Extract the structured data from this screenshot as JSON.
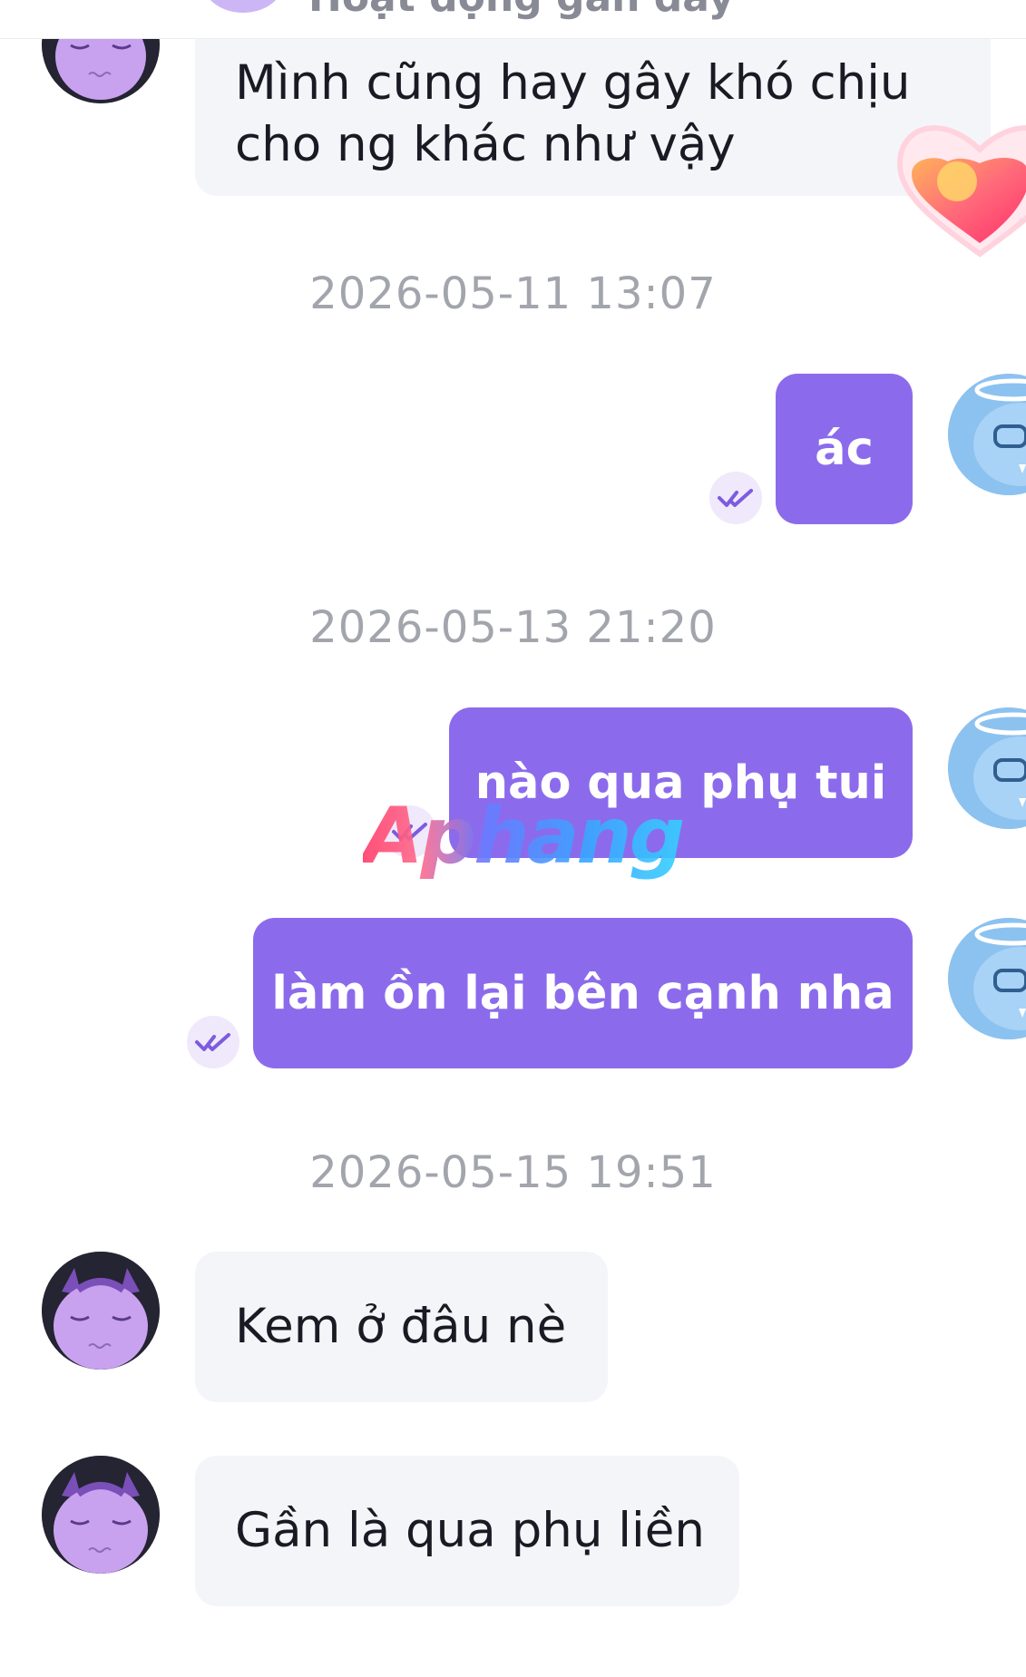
{
  "header": {
    "status": "Hoạt động gần đây"
  },
  "messages": [
    {
      "side": "in",
      "lines": [
        "Mình cũng hay gây khó chịu",
        "cho ng khác như vậy"
      ]
    },
    {
      "type": "timestamp",
      "text": "2026-05-11 13:07"
    },
    {
      "side": "out",
      "text": "ác",
      "read": true
    },
    {
      "type": "timestamp",
      "text": "2026-05-13 21:20"
    },
    {
      "side": "out",
      "text": "nào qua phụ tui",
      "read": true
    },
    {
      "side": "out",
      "text": "làm ồn lại bên cạnh nha",
      "read": true
    },
    {
      "type": "timestamp",
      "text": "2026-05-15 19:51"
    },
    {
      "side": "in",
      "text": "Kem ở đâu nè"
    },
    {
      "side": "in",
      "text": "Gần là qua phụ liền"
    }
  ],
  "watermark": {
    "text": "Aphang"
  },
  "icons": {
    "read_receipt": "double-check-icon",
    "reaction": "heart-icon"
  },
  "colors": {
    "outgoing_bubble": "#8b6bec",
    "incoming_bubble": "#f4f5f8",
    "timestamp": "#a3a5ad"
  }
}
